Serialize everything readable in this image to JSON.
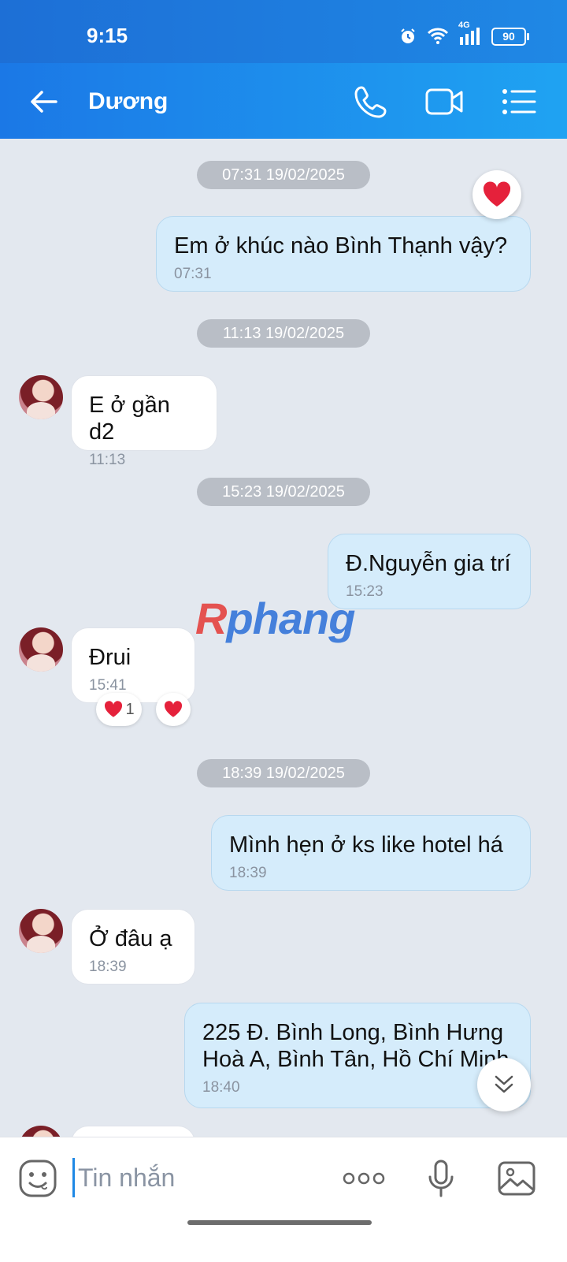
{
  "status_bar": {
    "time": "9:15",
    "battery": "90",
    "network": "4G"
  },
  "header": {
    "contact_name": "Dương"
  },
  "messages": [
    {
      "kind": "date",
      "text": "07:31 19/02/2025"
    },
    {
      "kind": "out",
      "text": "Em ở khúc nào Bình Thạnh vậy?",
      "time": "07:31",
      "reaction": "heart"
    },
    {
      "kind": "date",
      "text": "11:13 19/02/2025"
    },
    {
      "kind": "in",
      "text": "E ở gần d2",
      "time": "11:13"
    },
    {
      "kind": "date",
      "text": "15:23 19/02/2025"
    },
    {
      "kind": "out",
      "text": "Đ.Nguyễn gia trí",
      "time": "15:23"
    },
    {
      "kind": "in",
      "text": "Đrui",
      "time": "15:41",
      "reaction_count": "1"
    },
    {
      "kind": "date",
      "text": "18:39 19/02/2025"
    },
    {
      "kind": "out",
      "text": "Mình hẹn ở ks like hotel há",
      "time": "18:39"
    },
    {
      "kind": "in",
      "text": "Ở đâu ạ",
      "time": "18:39"
    },
    {
      "kind": "out",
      "text_line1": "225 Đ. Bình Long, Bình Hưng",
      "text_line2": "Hoà A, Bình Tân, Hồ Chí Minh",
      "time": "18:40"
    }
  ],
  "watermark": {
    "part1": "R",
    "part2": "phang"
  },
  "input": {
    "placeholder": "Tin nhắn"
  },
  "colors": {
    "header_start": "#1b78e6",
    "header_end": "#1fa3f2",
    "out_bubble": "#d5ecfb",
    "chat_bg": "#e3e8ef",
    "heart": "#e5213b"
  }
}
